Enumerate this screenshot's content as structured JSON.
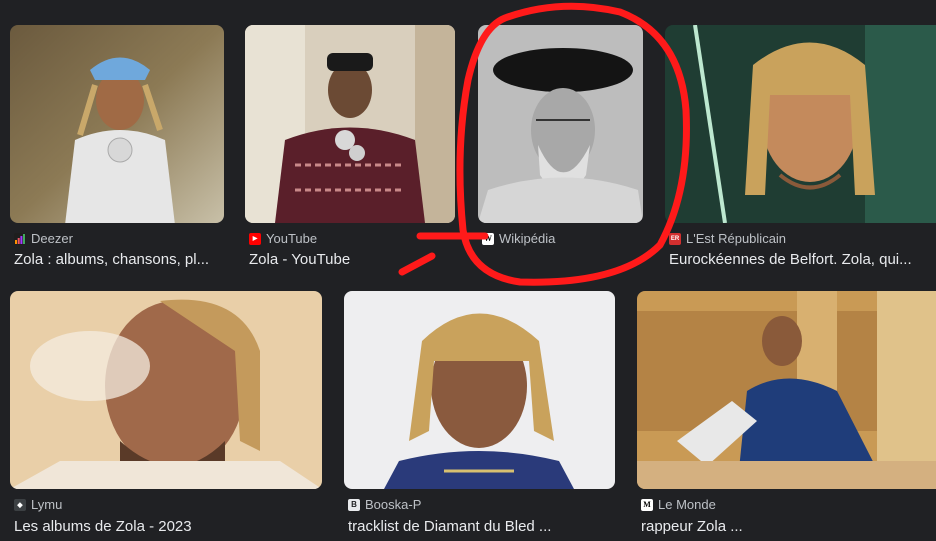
{
  "results": [
    {
      "source": "Deezer",
      "title": "Zola : albums, chansons, pl...",
      "favicon": "deezer-icon",
      "accent": "#a238ff"
    },
    {
      "source": "YouTube",
      "title": "Zola - YouTube",
      "favicon": "youtube-icon",
      "accent": "#ff0000"
    },
    {
      "source": "Wikipédia",
      "title": "",
      "favicon": "wikipedia-icon",
      "accent": "#ffffff"
    },
    {
      "source": "L'Est Républicain",
      "title": "Eurockéennes de Belfort. Zola, qui...",
      "favicon": "est-republicain-icon",
      "accent": "#d32f2f"
    },
    {
      "source": "Lymu",
      "title": "Les albums de Zola - 2023",
      "favicon": "lymu-icon",
      "accent": "#3c4043"
    },
    {
      "source": "Booska-P",
      "title": "tracklist de Diamant du Bled ...",
      "favicon": "booska-p-icon",
      "accent": "#e8eaed"
    },
    {
      "source": "Le Monde",
      "title": "rappeur Zola ...",
      "favicon": "le-monde-icon",
      "accent": "#ffffff"
    }
  ],
  "favicon_glyphs": {
    "youtube": "▶",
    "wikipedia": "W",
    "est_republicain": "ER",
    "lymu": "◆",
    "booska_p": "B",
    "le_monde": "M"
  },
  "annotation_color": "#ff1a1a"
}
